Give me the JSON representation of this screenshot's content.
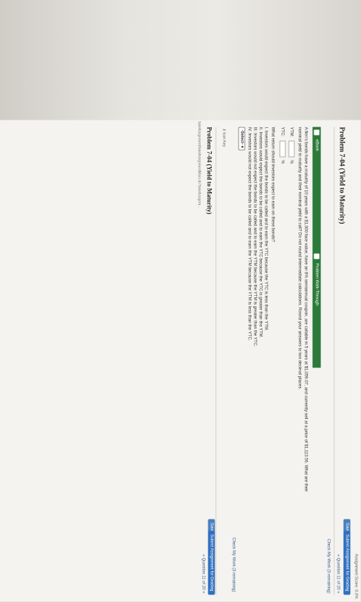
{
  "topbar": {
    "assignment_score": "Assignment Score: 0.0%"
  },
  "toolbar": {
    "save": "Save",
    "submit": "Submit Assignment for Grading",
    "question_nav": "« Question 11 of 20 »"
  },
  "problem": {
    "title": "Problem 7-04 (Yield to Maturity)",
    "check_work": "Check My Work (3 remaining)",
    "tab_ebook": "eBook",
    "tab_walkthrough": "Problem Walk-Through",
    "text_line1": "A firm's bonds have a maturity of 10 years with a $1,000 face value, have an 8% semiannual coupon, are callable in 5 years at $1,059.07, and currently sell at a price of $1,113.56. What are their",
    "text_line2": "nominal yield to maturity and their nominal yield to call? Do not round intermediate calculations. Round your answers to two decimal places.",
    "ytm_label": "YTM:",
    "ytc_label": "YTC:",
    "percent": "%",
    "question": "What return should investors expect to earn on these bonds?",
    "options": [
      "I. Investors would expect the bonds to be called and to earn the YTC because the YTC is less than the YTM.",
      "II. Investors would expect the bonds to be called and to earn the YTC because the YTC is greater than the YTM.",
      "III. Investors would not expect the bonds to be called and to earn the YTM because the YTM is greater than the YTC.",
      "IV. Investors would not expect the bonds to be called and to earn the YTM because the YTM is less than the YTC."
    ],
    "select": "-Select-",
    "check_work_2": "Check My Work (3 remaining)",
    "icon_key": "Icon Key"
  },
  "bottom": {
    "title": "Problem 7-04 (Yield to Maturity)",
    "save": "Save",
    "submit": "Submit Assignment for Grading",
    "question_nav": "« Question 11 of 20 »",
    "url": "takeAssignment/takeAssignmentMain.do?takeAssignm..."
  }
}
